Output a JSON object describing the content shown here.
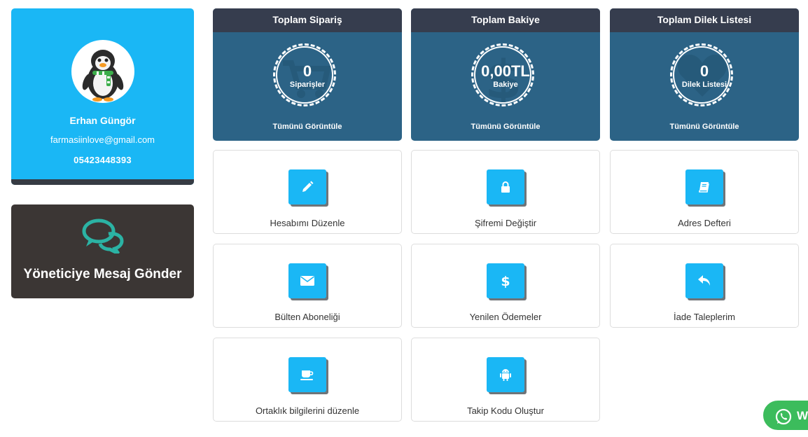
{
  "profile": {
    "name": "Erhan Güngör",
    "email": "farmasiinlove@gmail.com",
    "phone": "05423448393"
  },
  "message_card": {
    "label": "Yöneticiye Mesaj Gönder"
  },
  "stats": [
    {
      "title": "Toplam Sipariş",
      "value": "0",
      "sub": "Siparişler",
      "link": "Tümünü Görüntüle",
      "icon": "cart-icon"
    },
    {
      "title": "Toplam Bakiye",
      "value": "0,00TL",
      "sub": "Bakiye",
      "link": "Tümünü Görüntüle",
      "icon": "dollar-icon"
    },
    {
      "title": "Toplam Dilek Listesi",
      "value": "0",
      "sub": "Dilek Listesi",
      "link": "Tümünü Görüntüle",
      "icon": "heart-icon"
    }
  ],
  "tiles": [
    {
      "label": "Hesabımı Düzenle",
      "icon": "pencil-icon"
    },
    {
      "label": "Şifremi Değiştir",
      "icon": "lock-icon"
    },
    {
      "label": "Adres Defteri",
      "icon": "book-icon"
    },
    {
      "label": "Bülten Aboneliği",
      "icon": "envelope-icon"
    },
    {
      "label": "Yenilen Ödemeler",
      "icon": "dollar-icon"
    },
    {
      "label": "İade Taleplerim",
      "icon": "reply-icon"
    },
    {
      "label": "Ortaklık bilgilerini düzenle",
      "icon": "coffee-icon"
    },
    {
      "label": "Takip Kodu Oluştur",
      "icon": "android-icon"
    }
  ],
  "whatsapp": {
    "label": "W"
  },
  "colors": {
    "accent": "#1ab7f5",
    "stat_body": "#2c6386",
    "stat_header": "#363d4e",
    "message_bg": "#3b3634",
    "chat_icon": "#2bb3a4",
    "whatsapp": "#3cbc5c"
  }
}
